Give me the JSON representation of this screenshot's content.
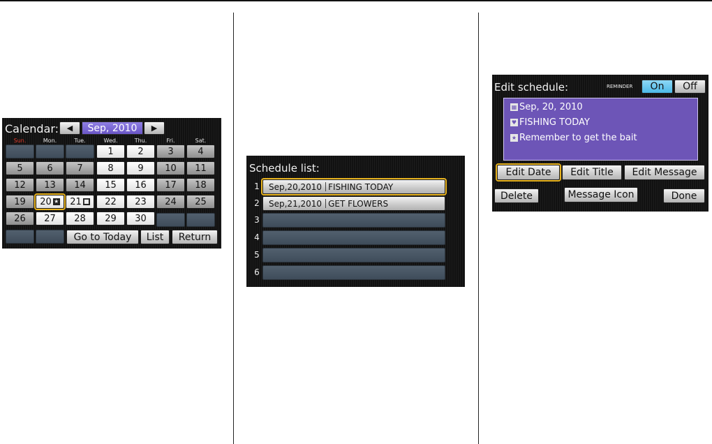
{
  "calendar": {
    "title": "Calendar:",
    "month": "Sep, 2010",
    "prev_icon": "◀",
    "next_icon": "▶",
    "weekdays": [
      "Sun.",
      "Mon.",
      "Tue.",
      "Wed.",
      "Thu.",
      "Fri.",
      "Sat."
    ],
    "days": [
      "1",
      "2",
      "3",
      "4",
      "5",
      "6",
      "7",
      "8",
      "9",
      "10",
      "11",
      "12",
      "13",
      "14",
      "15",
      "16",
      "17",
      "18",
      "19",
      "20",
      "21",
      "22",
      "23",
      "24",
      "25",
      "26",
      "27",
      "28",
      "29",
      "30"
    ],
    "day_icons": {
      "20": "star-icon",
      "21": "person-icon"
    },
    "buttons": {
      "today": "Go to Today",
      "list": "List",
      "return": "Return"
    }
  },
  "schedule_list": {
    "title": "Schedule list:",
    "rows": [
      {
        "num": "1",
        "date": "Sep,20,2010",
        "title": "FISHING TODAY"
      },
      {
        "num": "2",
        "date": "Sep,21,2010",
        "title": "GET FLOWERS"
      },
      {
        "num": "3",
        "date": "",
        "title": ""
      },
      {
        "num": "4",
        "date": "",
        "title": ""
      },
      {
        "num": "5",
        "date": "",
        "title": ""
      },
      {
        "num": "6",
        "date": "",
        "title": ""
      }
    ]
  },
  "edit_schedule": {
    "title": "Edit schedule:",
    "reminder_label": "REMINDER",
    "on_label": "On",
    "off_label": "Off",
    "date_line": "Sep, 20, 2010",
    "title_line": "FISHING TODAY",
    "message_line": "Remember to get the bait",
    "buttons": {
      "edit_date": "Edit Date",
      "edit_title": "Edit Title",
      "edit_message": "Edit Message",
      "delete": "Delete",
      "message_icon": "Message Icon",
      "done": "Done"
    }
  },
  "colors": {
    "highlight": "#e8b31f",
    "panel_purple": "#6d55b7",
    "on_active": "#5cc4ef",
    "sunday_red": "#e23a2a"
  }
}
